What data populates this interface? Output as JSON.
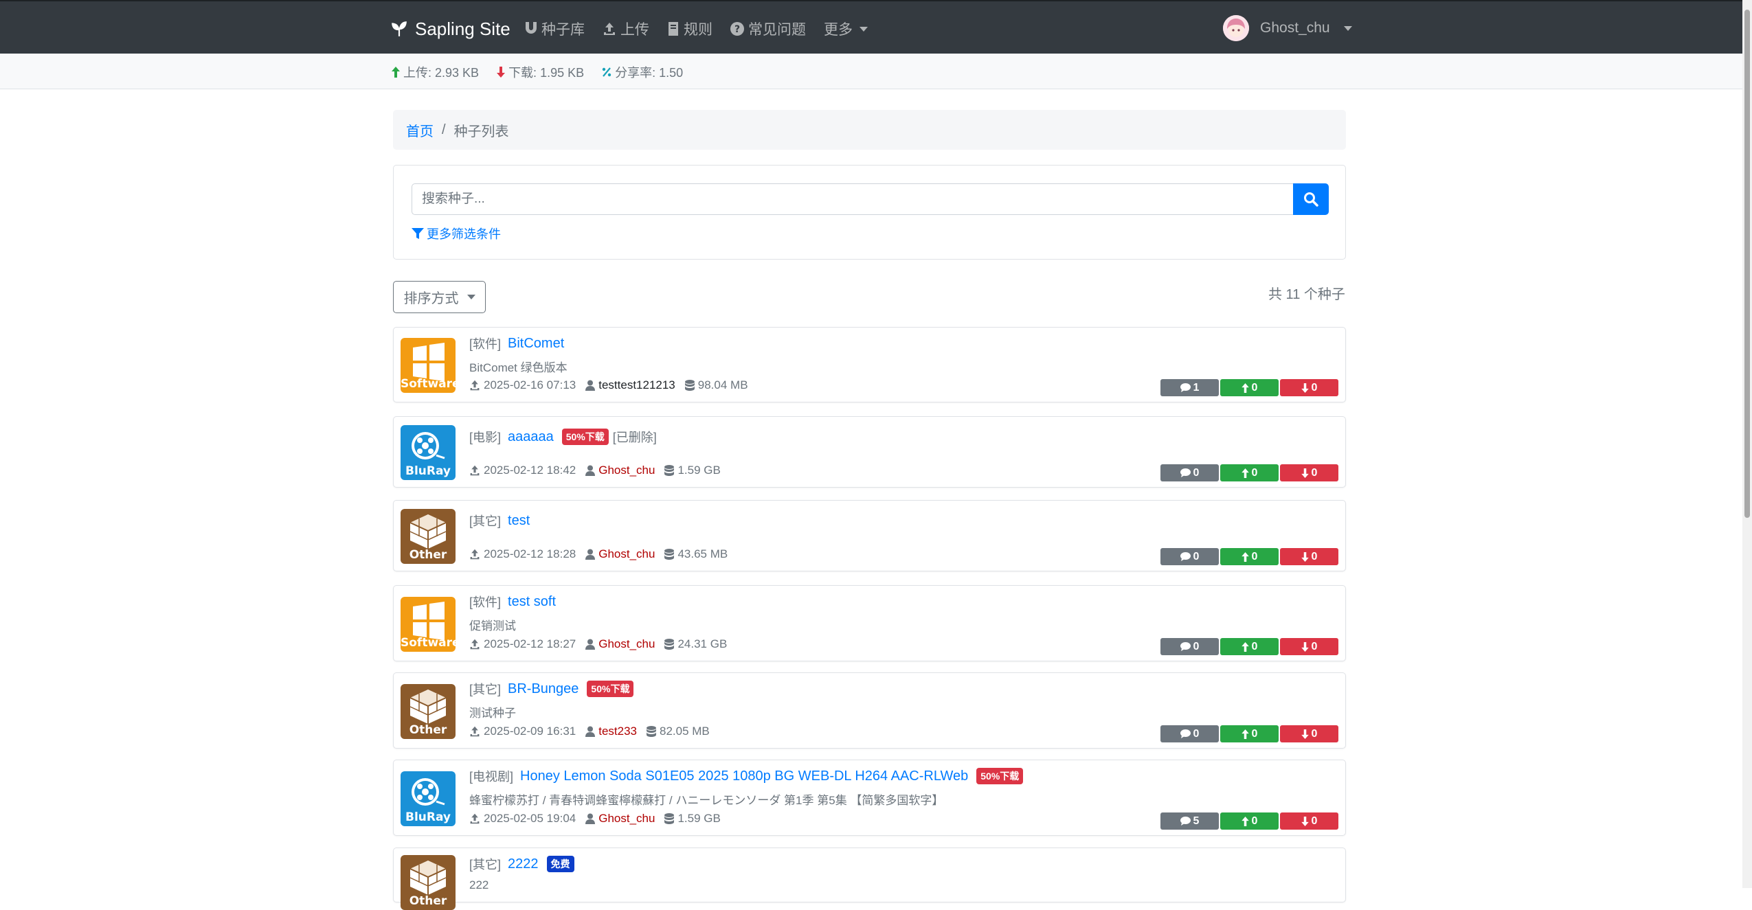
{
  "navbar": {
    "brand": "Sapling Site",
    "links": [
      {
        "label": "种子库",
        "icon": "magnet-icon"
      },
      {
        "label": "上传",
        "icon": "upload-icon"
      },
      {
        "label": "规则",
        "icon": "book-icon"
      },
      {
        "label": "常见问题",
        "icon": "question-circle-icon"
      },
      {
        "label": "更多",
        "icon": "caret-down-icon"
      }
    ],
    "username": "Ghost_chu"
  },
  "stats": {
    "upload": "上传: 2.93 KB",
    "download": "下载: 1.95 KB",
    "ratio": "分享率: 1.50",
    "colors": {
      "upload": "#28a745",
      "download": "#dc3545",
      "ratio": "#17a2b8"
    }
  },
  "breadcrumb": {
    "home": "首页",
    "separator": "/",
    "current": "种子列表"
  },
  "search": {
    "placeholder": "搜索种子...",
    "more_filters": "更多筛选条件"
  },
  "sort": {
    "label": "排序方式"
  },
  "count_text": "共 11 个种子",
  "torrents": [
    {
      "category_tag": "[软件]",
      "category_image": "Software",
      "title": "BitComet",
      "badge": "",
      "deleted": "",
      "subtitle": "BitComet 绿色版本",
      "date": "2025-02-16 07:13",
      "uploader": "testtest121213",
      "size": "98.04 MB",
      "comments": "1",
      "seeders": "0",
      "leechers": "0"
    },
    {
      "category_tag": "[电影]",
      "category_image": "BluRay",
      "title": "aaaaaa",
      "badge": "50%下载",
      "deleted": "[已删除]",
      "subtitle": "",
      "date": "2025-02-12 18:42",
      "uploader": "Ghost_chu",
      "size": "1.59 GB",
      "comments": "0",
      "seeders": "0",
      "leechers": "0"
    },
    {
      "category_tag": "[其它]",
      "category_image": "Other",
      "title": "test",
      "badge": "",
      "deleted": "",
      "subtitle": "",
      "date": "2025-02-12 18:28",
      "uploader": "Ghost_chu",
      "size": "43.65 MB",
      "comments": "0",
      "seeders": "0",
      "leechers": "0"
    },
    {
      "category_tag": "[软件]",
      "category_image": "Software",
      "title": "test soft",
      "badge": "",
      "deleted": "",
      "subtitle": "促销测试",
      "date": "2025-02-12 18:27",
      "uploader": "Ghost_chu",
      "size": "24.31 GB",
      "comments": "0",
      "seeders": "0",
      "leechers": "0"
    },
    {
      "category_tag": "[其它]",
      "category_image": "Other",
      "title": "BR-Bungee",
      "badge": "50%下载",
      "deleted": "",
      "subtitle": "测试种子",
      "date": "2025-02-09 16:31",
      "uploader": "test233",
      "size": "82.05 MB",
      "comments": "0",
      "seeders": "0",
      "leechers": "0"
    },
    {
      "category_tag": "[电视剧]",
      "category_image": "BluRay",
      "title": "Honey Lemon Soda S01E05 2025 1080p BG WEB-DL H264 AAC-RLWeb",
      "badge": "50%下载",
      "deleted": "",
      "subtitle": "蜂蜜柠檬苏打 / 青春特调蜂蜜檸檬蘇打 / ハニーレモンソーダ 第1季 第5集 【简繁多国软字】",
      "date": "2025-02-05 19:04",
      "uploader": "Ghost_chu",
      "size": "1.59 GB",
      "comments": "5",
      "seeders": "0",
      "leechers": "0"
    },
    {
      "category_tag": "[其它]",
      "category_image": "Other",
      "title": "2222",
      "badge": "免费",
      "deleted": "",
      "subtitle": "222"
    }
  ]
}
